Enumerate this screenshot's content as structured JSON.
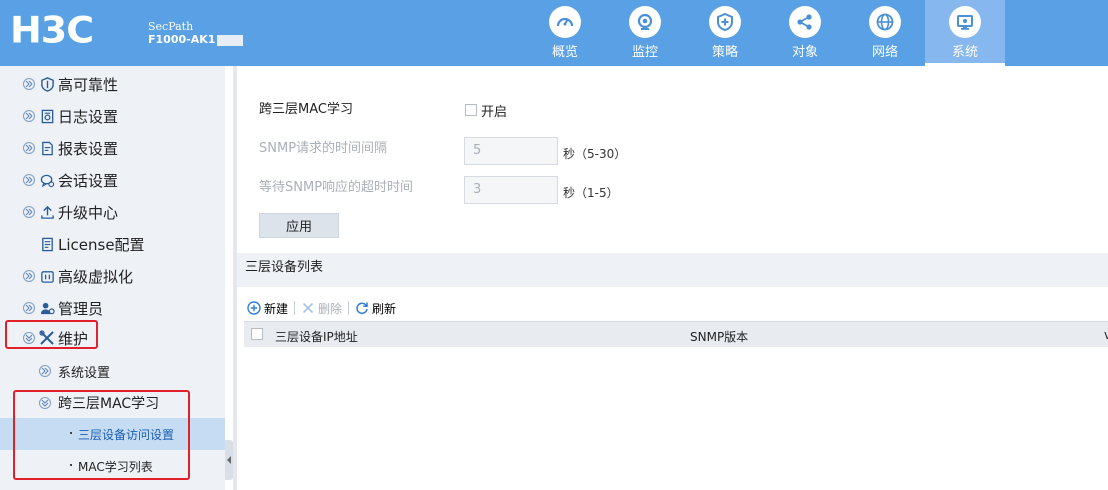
{
  "header": {
    "logo": "H3C",
    "product_line1": "SecPath",
    "product_line2": "F1000-AK1",
    "nav": [
      {
        "label": "概览",
        "icon": "dashboard-gauge-icon"
      },
      {
        "label": "监控",
        "icon": "monitor-camera-icon"
      },
      {
        "label": "策略",
        "icon": "shield-plus-icon"
      },
      {
        "label": "对象",
        "icon": "share-nodes-icon"
      },
      {
        "label": "网络",
        "icon": "globe-icon"
      },
      {
        "label": "系统",
        "icon": "system-monitor-icon",
        "active": true
      }
    ]
  },
  "sidebar": {
    "items": [
      {
        "label": "高可靠性",
        "icon": "shield-icon"
      },
      {
        "label": "日志设置",
        "icon": "log-settings-icon"
      },
      {
        "label": "报表设置",
        "icon": "report-icon"
      },
      {
        "label": "会话设置",
        "icon": "session-chat-icon"
      },
      {
        "label": "升级中心",
        "icon": "upload-icon"
      },
      {
        "label": "License配置",
        "icon": "license-icon"
      },
      {
        "label": "高级虚拟化",
        "icon": "virtualization-icon"
      },
      {
        "label": "管理员",
        "icon": "admin-users-icon"
      },
      {
        "label": "维护",
        "icon": "tools-icon"
      }
    ],
    "sub_items": {
      "system_settings": "系统设置",
      "cross_l3_mac": "跨三层MAC学习",
      "l3_device_access": "三层设备访问设置",
      "mac_learn_list": "MAC学习列表"
    }
  },
  "form": {
    "cross_l3_label": "跨三层MAC学习",
    "enable_label": "开启",
    "snmp_interval_label": "SNMP请求的时间间隔",
    "snmp_interval_value": "5",
    "snmp_interval_unit": "秒（5-30）",
    "snmp_timeout_label": "等待SNMP响应的超时时间",
    "snmp_timeout_value": "3",
    "snmp_timeout_unit": "秒（1-5）",
    "apply_label": "应用"
  },
  "device_list": {
    "title": "三层设备列表",
    "toolbar": {
      "new": "新建",
      "delete": "删除",
      "refresh": "刷新"
    },
    "columns": [
      "三层设备IP地址",
      "SNMP版本",
      "v"
    ]
  },
  "colors": {
    "header_bg": "#5aa0e4",
    "nav_active": "#86b7ee",
    "sidebar_bg": "#eef2f7",
    "highlight_red": "#e0202a"
  }
}
